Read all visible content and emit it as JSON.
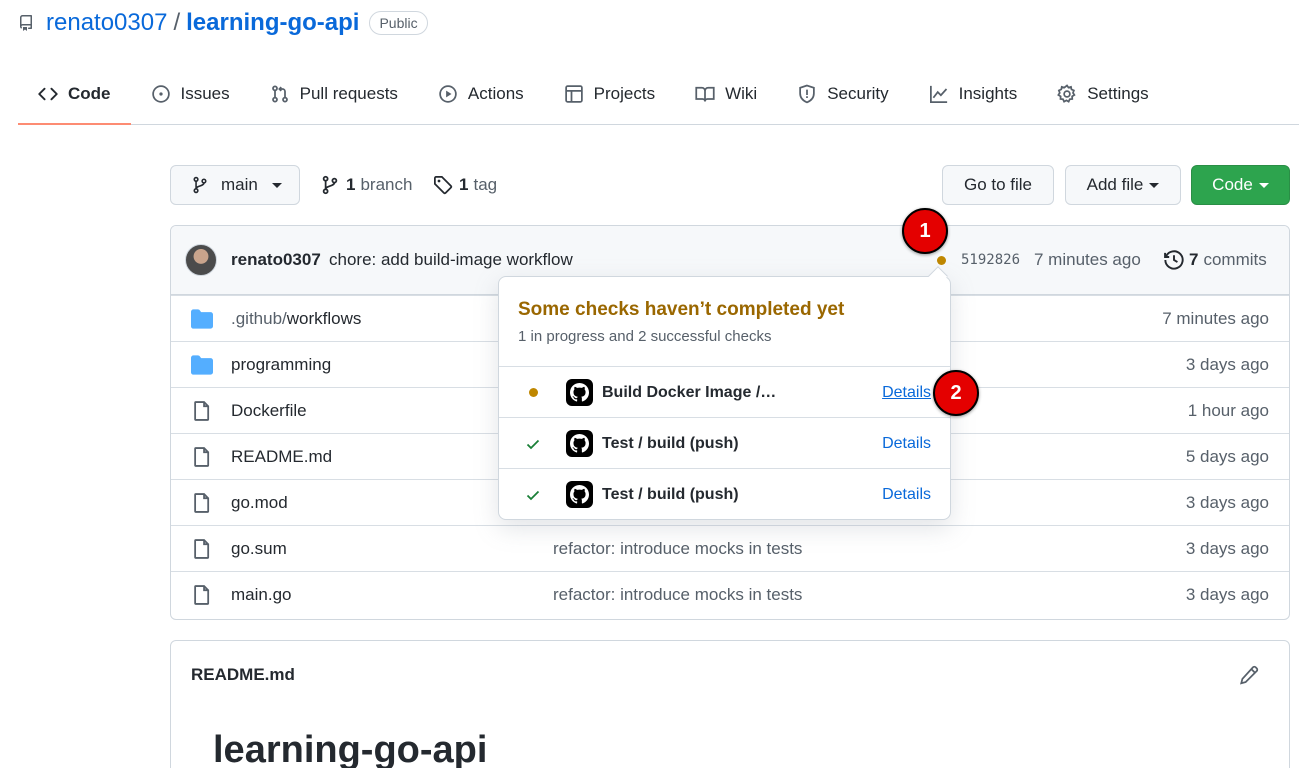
{
  "repo": {
    "owner": "renato0307",
    "separator": "/",
    "name": "learning-go-api",
    "visibility": "Public"
  },
  "tabs": [
    {
      "label": "Code",
      "icon": "code-icon",
      "active": true
    },
    {
      "label": "Issues",
      "icon": "issue-icon"
    },
    {
      "label": "Pull requests",
      "icon": "pull-request-icon"
    },
    {
      "label": "Actions",
      "icon": "play-icon"
    },
    {
      "label": "Projects",
      "icon": "table-icon"
    },
    {
      "label": "Wiki",
      "icon": "book-icon"
    },
    {
      "label": "Security",
      "icon": "shield-icon"
    },
    {
      "label": "Insights",
      "icon": "graph-icon"
    },
    {
      "label": "Settings",
      "icon": "gear-icon"
    }
  ],
  "toolbar": {
    "branch": "main",
    "branch_count": "1",
    "branch_word": "branch",
    "tag_count": "1",
    "tag_word": "tag",
    "go_to_file": "Go to file",
    "add_file": "Add file",
    "code": "Code"
  },
  "commit": {
    "author": "renato0307",
    "message": "chore: add build-image workflow",
    "sha": "5192826",
    "time": "7 minutes ago",
    "commit_count": "7",
    "commits_word": "commits",
    "status_color": "#bf8700"
  },
  "files": [
    {
      "type": "dir",
      "prefix": ".github/",
      "name": "workflows",
      "message": "",
      "age": "7 minutes ago"
    },
    {
      "type": "dir",
      "prefix": "",
      "name": "programming",
      "message": "",
      "age": "3 days ago"
    },
    {
      "type": "file",
      "prefix": "",
      "name": "Dockerfile",
      "message": "",
      "age": "1 hour ago"
    },
    {
      "type": "file",
      "prefix": "",
      "name": "README.md",
      "message": "",
      "age": "5 days ago"
    },
    {
      "type": "file",
      "prefix": "",
      "name": "go.mod",
      "message": "",
      "age": "3 days ago"
    },
    {
      "type": "file",
      "prefix": "",
      "name": "go.sum",
      "message": "refactor: introduce mocks in tests",
      "age": "3 days ago"
    },
    {
      "type": "file",
      "prefix": "",
      "name": "main.go",
      "message": "refactor: introduce mocks in tests",
      "age": "3 days ago"
    }
  ],
  "popover": {
    "title": "Some checks haven’t completed yet",
    "subtitle": "1 in progress and 2 successful checks",
    "checks": [
      {
        "status": "in-progress",
        "name": "Build Docker Image /…",
        "details": "Details"
      },
      {
        "status": "success",
        "name": "Test / build (push)",
        "details": "Details"
      },
      {
        "status": "success",
        "name": "Test / build (push)",
        "details": "Details"
      }
    ]
  },
  "readme": {
    "title": "README.md",
    "heading": "learning-go-api"
  },
  "markers": [
    "1",
    "2"
  ],
  "colors": {
    "link": "#0969da",
    "success": "#1a7f37",
    "pending": "#bf8700",
    "green_button": "#2da44e",
    "marker": "#e40000",
    "active_tab": "#fd8c73"
  }
}
